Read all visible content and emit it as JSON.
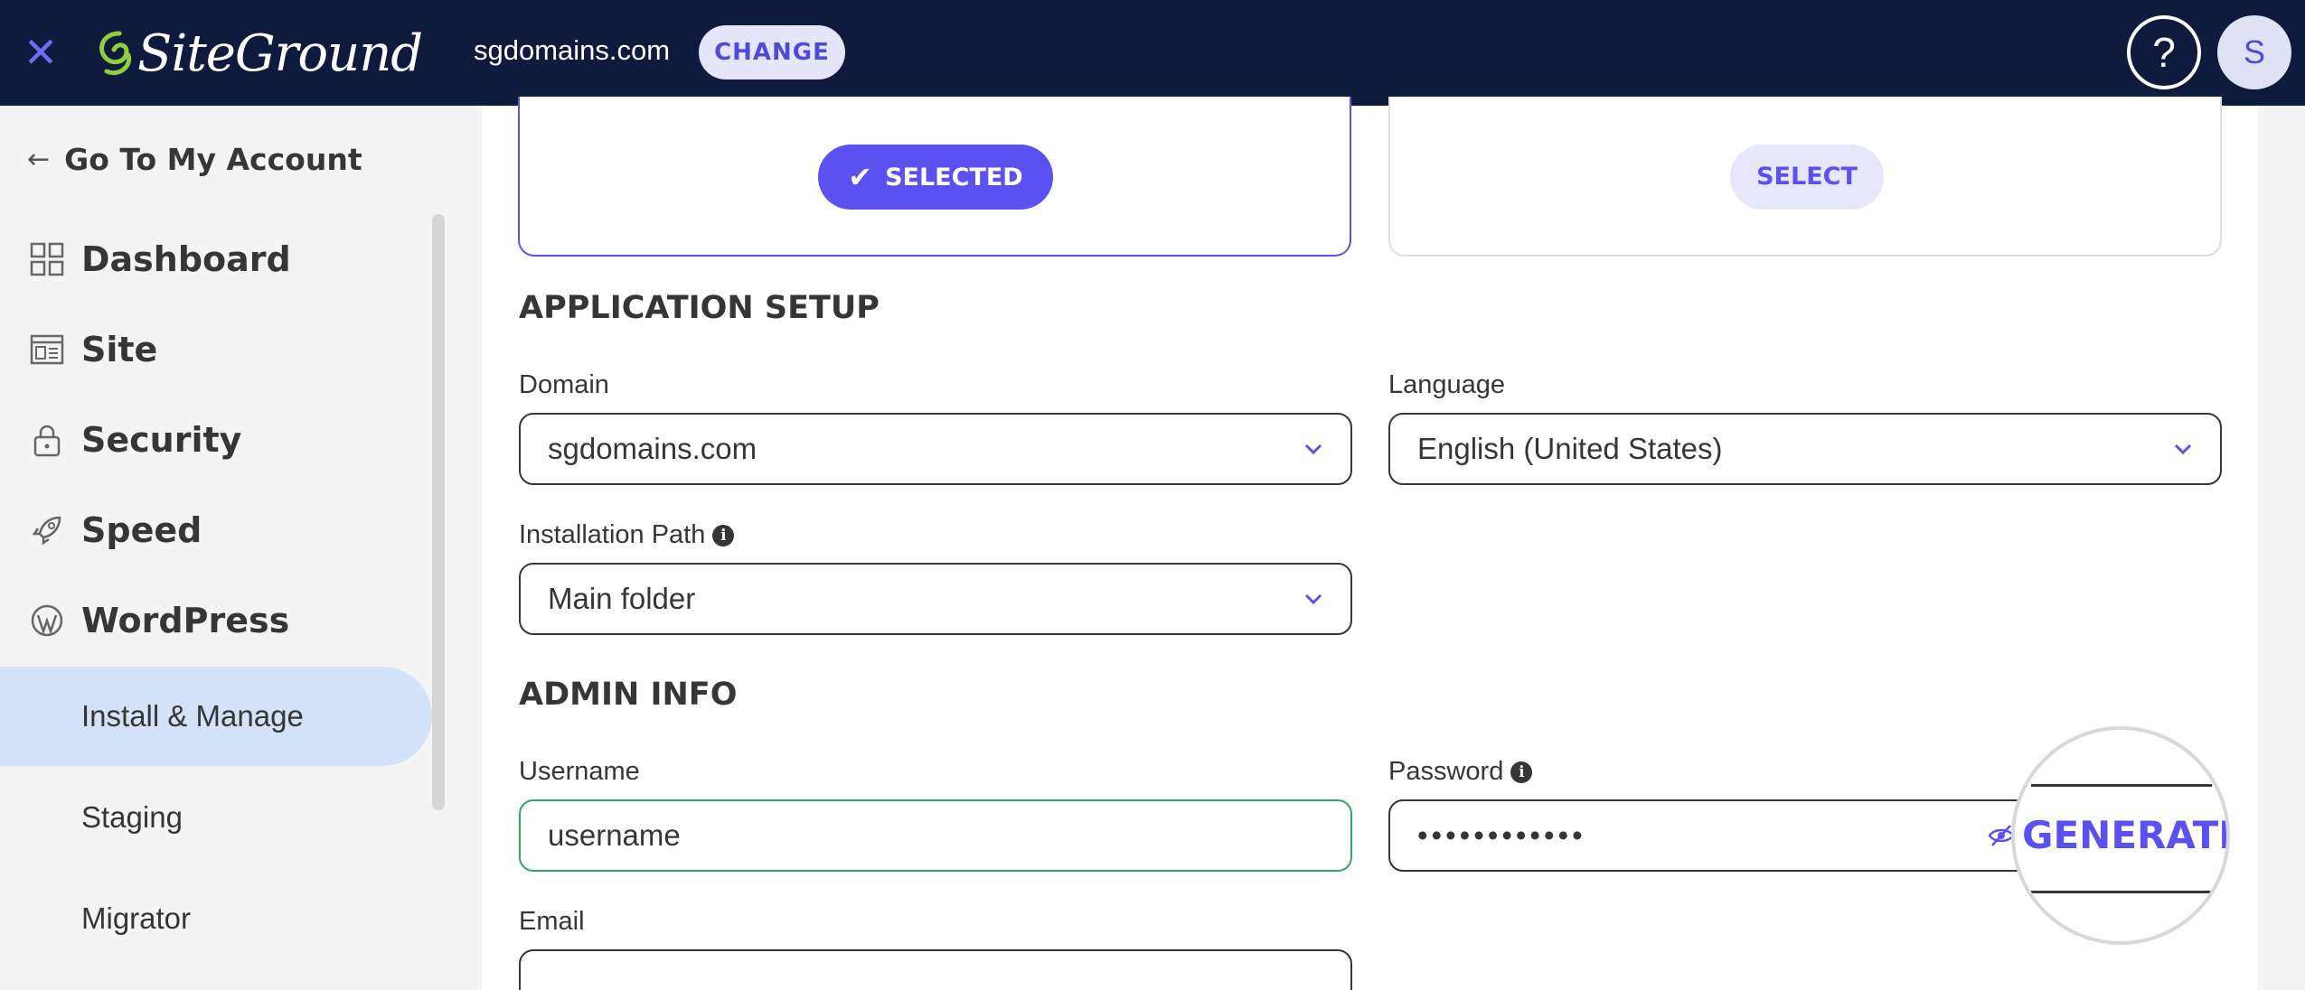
{
  "topbar": {
    "logo_text": "SiteGround",
    "domain": "sgdomains.com",
    "change_label": "CHANGE",
    "help_label": "?",
    "avatar_initial": "S"
  },
  "sidebar": {
    "back_label": "Go To My Account",
    "items": [
      {
        "label": "Dashboard",
        "icon": "dashboard-icon"
      },
      {
        "label": "Site",
        "icon": "site-icon"
      },
      {
        "label": "Security",
        "icon": "lock-icon"
      },
      {
        "label": "Speed",
        "icon": "rocket-icon"
      },
      {
        "label": "WordPress",
        "icon": "wordpress-icon"
      }
    ],
    "sub_items": [
      {
        "label": "Install & Manage",
        "active": true
      },
      {
        "label": "Staging",
        "active": false
      },
      {
        "label": "Migrator",
        "active": false
      }
    ]
  },
  "cards": {
    "selected_label": "SELECTED",
    "select_label": "SELECT"
  },
  "app_setup": {
    "title": "APPLICATION SETUP",
    "domain_label": "Domain",
    "domain_value": "sgdomains.com",
    "language_label": "Language",
    "language_value": "English (United States)",
    "path_label": "Installation Path",
    "path_value": "Main folder"
  },
  "admin_info": {
    "title": "ADMIN INFO",
    "username_label": "Username",
    "username_value": "username",
    "password_label": "Password",
    "password_value": "••••••••••••",
    "generate_label": "GENERATE",
    "email_label": "Email",
    "email_value": ""
  },
  "colors": {
    "topbar_bg": "#0f1b3d",
    "accent": "#5b50f0",
    "active_nav_bg": "#d3e2f8",
    "success_border": "#2fa862"
  }
}
